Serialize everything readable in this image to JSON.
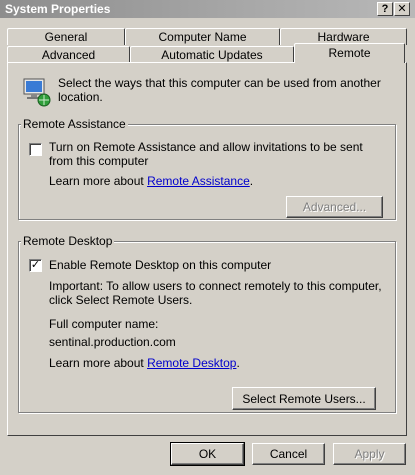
{
  "window": {
    "title": "System Properties",
    "help_label": "?",
    "close_label": "✕"
  },
  "tabs_row1": [
    {
      "label": "General"
    },
    {
      "label": "Computer Name"
    },
    {
      "label": "Hardware"
    }
  ],
  "tabs_row2": [
    {
      "label": "Advanced"
    },
    {
      "label": "Automatic Updates"
    },
    {
      "label": "Remote",
      "active": true
    }
  ],
  "intro": {
    "text": "Select the ways that this computer can be used from another location.",
    "icon": "remote-computer-icon"
  },
  "remote_assistance": {
    "legend": "Remote Assistance",
    "checkbox_label": "Turn on Remote Assistance and allow invitations to be sent from this computer",
    "checked": false,
    "learn_prefix": "Learn more about ",
    "learn_link": "Remote Assistance",
    "learn_suffix": ".",
    "advanced_button": "Advanced..."
  },
  "remote_desktop": {
    "legend": "Remote Desktop",
    "checkbox_label": "Enable Remote Desktop on this computer",
    "checked": true,
    "check_mark": "✓",
    "important_text": "Important: To allow users to connect remotely to this computer, click Select Remote Users.",
    "full_name_label": "Full computer name:",
    "full_name_value": "sentinal.production.com",
    "learn_prefix": "Learn more about ",
    "learn_link": "Remote Desktop",
    "learn_suffix": ".",
    "select_users_button": "Select Remote Users..."
  },
  "footer": {
    "ok": "OK",
    "cancel": "Cancel",
    "apply": "Apply"
  },
  "colors": {
    "dialog_bg": "#d4d0c8",
    "link": "#0000cc",
    "titlebar": "#9a9a9a"
  }
}
